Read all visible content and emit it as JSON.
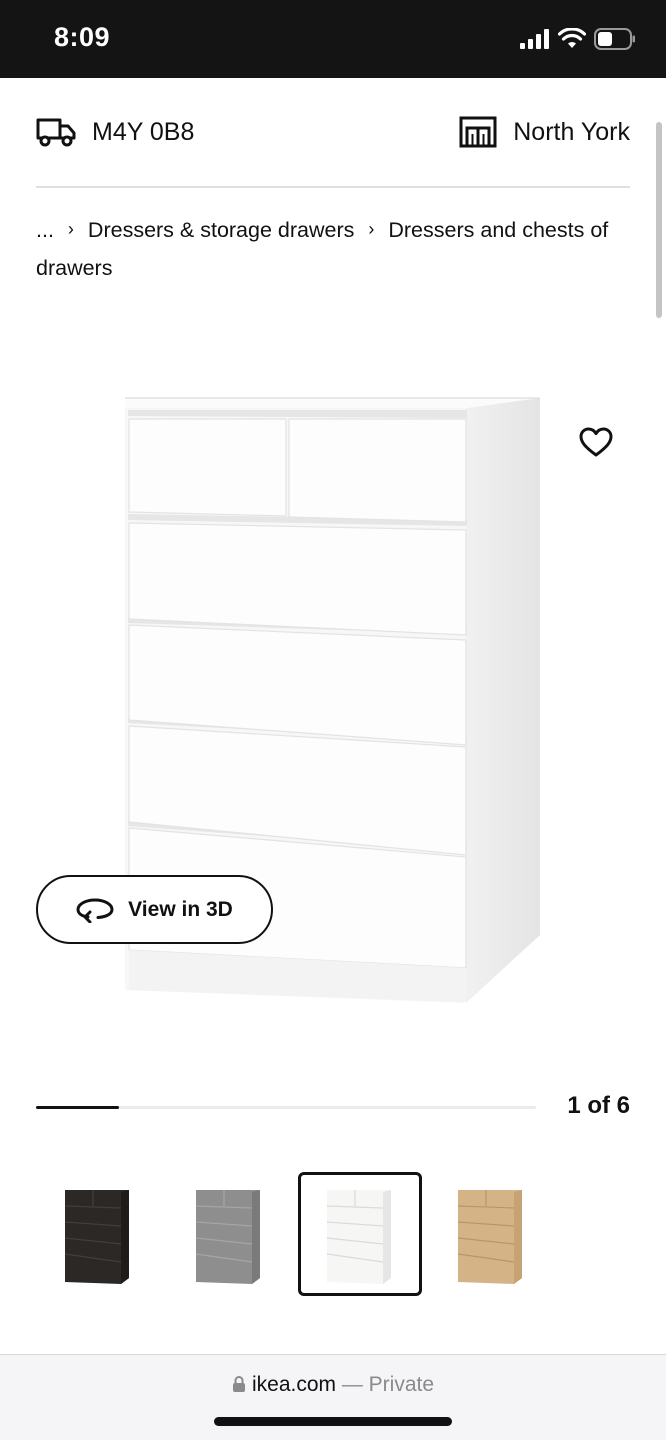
{
  "status_bar": {
    "time": "8:09",
    "icons": [
      "signal-icon",
      "wifi-icon",
      "battery-icon"
    ]
  },
  "location": {
    "postal_code": "M4Y 0B8",
    "postal_icon": "delivery-truck-icon",
    "store": "North York",
    "store_icon": "store-icon"
  },
  "breadcrumb": {
    "ellipsis": "...",
    "items": [
      "Dressers & storage drawers",
      "Dressers and chests of drawers"
    ]
  },
  "product": {
    "image_icon": "white-dresser-image",
    "favorite_icon": "heart-icon",
    "view3d_label": "View in 3D",
    "view3d_icon": "rotate-3d-icon"
  },
  "carousel": {
    "page_text": "1 of 6",
    "current": 1,
    "total": 6
  },
  "thumbnails": [
    {
      "name": "black-brown-dresser",
      "color": "#2b2826",
      "selected": false
    },
    {
      "name": "gray-dresser",
      "color": "#8e8e8e",
      "selected": false
    },
    {
      "name": "white-dresser",
      "color": "#f4f4f2",
      "selected": true
    },
    {
      "name": "oak-dresser",
      "color": "#d4b487",
      "selected": false
    }
  ],
  "browser": {
    "host": "ikea.com",
    "separator": " — ",
    "mode": "Private"
  },
  "colors": {
    "status_bg": "#141414",
    "text": "#111111",
    "muted": "#8a8a8e"
  }
}
